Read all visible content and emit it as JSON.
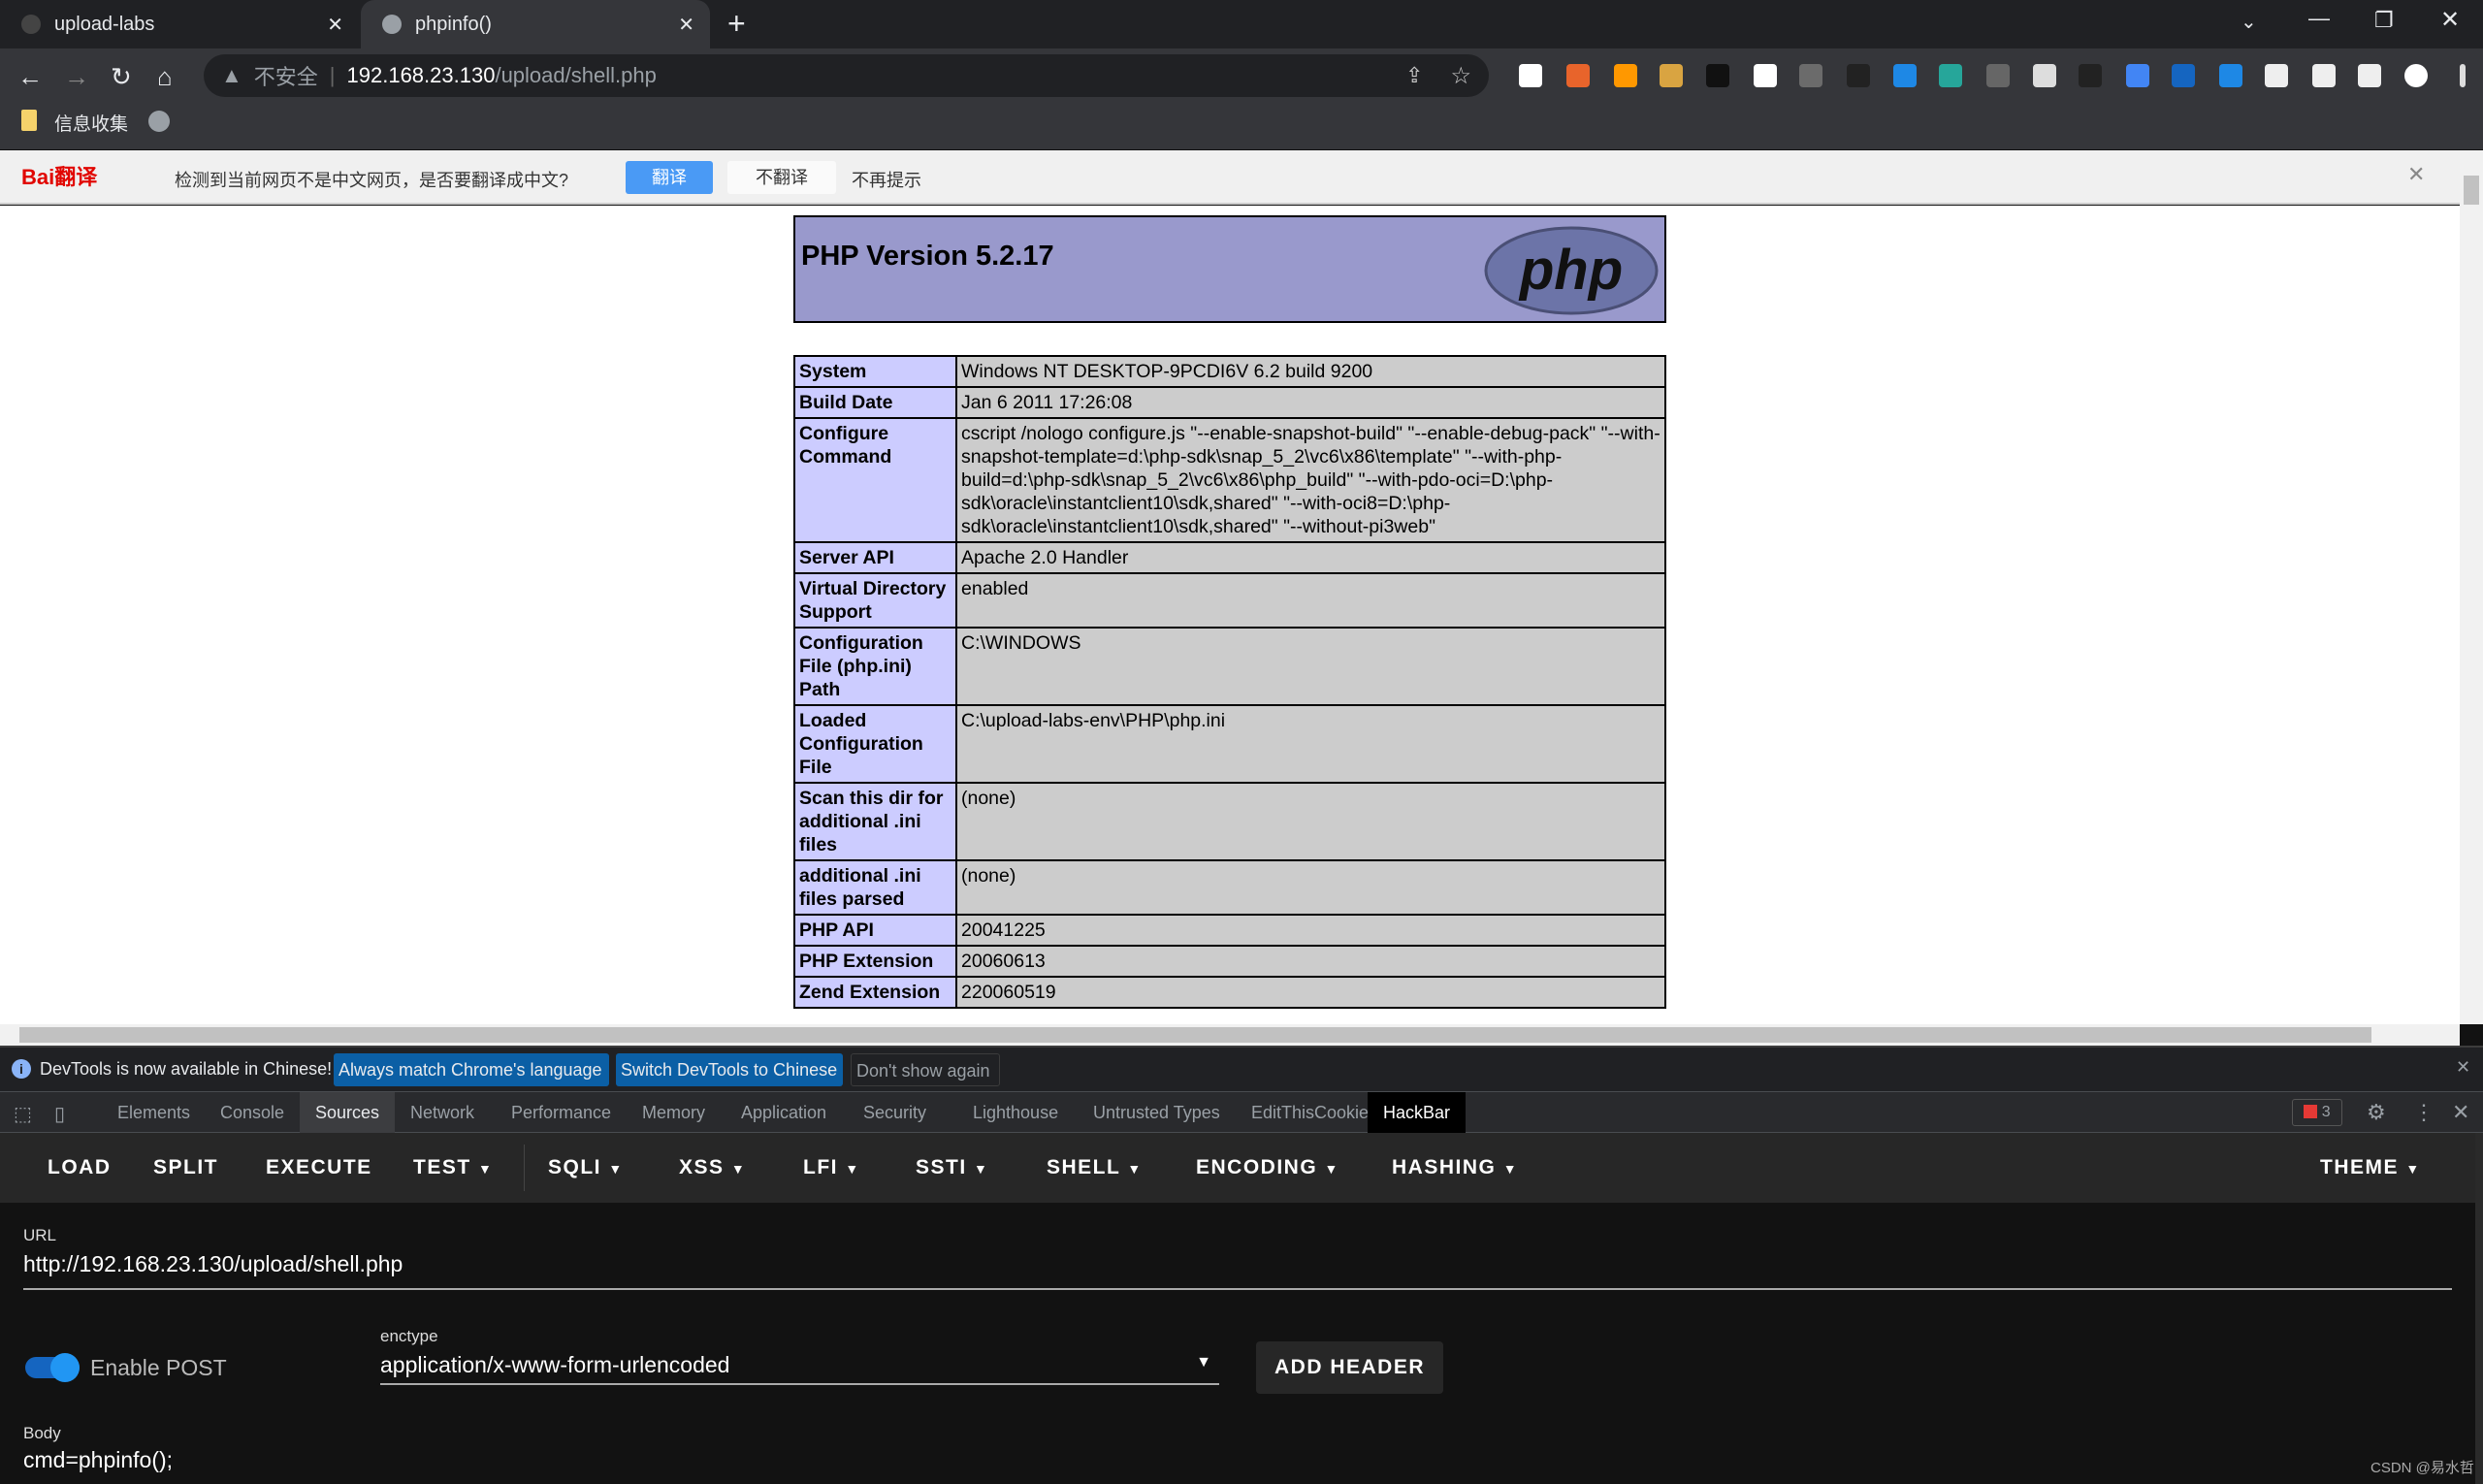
{
  "browser": {
    "tabs": [
      {
        "title": "upload-labs",
        "icon": "page-icon"
      },
      {
        "title": "phpinfo()",
        "icon": "globe-icon"
      }
    ],
    "address": {
      "security": "不安全",
      "host": "192.168.23.130",
      "path": "/upload/shell.php"
    },
    "bookmarks": [
      {
        "label": "信息收集",
        "icon": "folder-icon"
      }
    ],
    "extensions": [
      "search-icon",
      "opera-icon",
      "wappalyzer-icon",
      "cookie-icon",
      "hackbar-icon",
      "proxy-icon",
      "code-icon",
      "glasses-icon",
      "mask-icon",
      "devtools-icon",
      "notepad-icon",
      "cloud-icon",
      "hat-icon",
      "google-translate-icon",
      "translate-icon",
      "baidu-translate-icon",
      "puzzle-icon",
      "flask-icon",
      "sidepanel-icon",
      "profile-icon",
      "menu-icon"
    ],
    "ext_colors": [
      "#ffffff",
      "#e8642b",
      "#ff9800",
      "#d9a441",
      "#111111",
      "#ffffff",
      "#6b6b6b",
      "#222222",
      "#1e88e5",
      "#26a69a",
      "#666666",
      "#dddddd",
      "#222222",
      "#4285f4",
      "#1565c0",
      "#1e88e5",
      "#eeeeee",
      "#eeeeee",
      "#eeeeee",
      "#ffffff",
      "#dddddd"
    ]
  },
  "translate_bar": {
    "brand": "Bai翻译",
    "message": "检测到当前网页不是中文网页，是否要翻译成中文?",
    "translate": "翻译",
    "no_translate": "不翻译",
    "never": "不再提示"
  },
  "phpinfo": {
    "title": "PHP Version 5.2.17",
    "logo": "php",
    "rows": [
      {
        "k": "System",
        "v": "Windows NT DESKTOP-9PCDI6V 6.2 build 9200"
      },
      {
        "k": "Build Date",
        "v": "Jan 6 2011 17:26:08"
      },
      {
        "k": "Configure Command",
        "v": "cscript /nologo configure.js \"--enable-snapshot-build\" \"--enable-debug-pack\" \"--with-snapshot-template=d:\\php-sdk\\snap_5_2\\vc6\\x86\\template\" \"--with-php-build=d:\\php-sdk\\snap_5_2\\vc6\\x86\\php_build\" \"--with-pdo-oci=D:\\php-sdk\\oracle\\instantclient10\\sdk,shared\" \"--with-oci8=D:\\php-sdk\\oracle\\instantclient10\\sdk,shared\" \"--without-pi3web\""
      },
      {
        "k": "Server API",
        "v": "Apache 2.0 Handler"
      },
      {
        "k": "Virtual Directory Support",
        "v": "enabled"
      },
      {
        "k": "Configuration File (php.ini) Path",
        "v": "C:\\WINDOWS"
      },
      {
        "k": "Loaded Configuration File",
        "v": "C:\\upload-labs-env\\PHP\\php.ini"
      },
      {
        "k": "Scan this dir for additional .ini files",
        "v": "(none)"
      },
      {
        "k": "additional .ini files parsed",
        "v": "(none)"
      },
      {
        "k": "PHP API",
        "v": "20041225"
      },
      {
        "k": "PHP Extension",
        "v": "20060613"
      },
      {
        "k": "Zend Extension",
        "v": "220060519"
      }
    ]
  },
  "devtools": {
    "infobar": {
      "message": "DevTools is now available in Chinese!",
      "btn1": "Always match Chrome's language",
      "btn2": "Switch DevTools to Chinese",
      "btn3": "Don't show again"
    },
    "tabs": [
      "Elements",
      "Console",
      "Sources",
      "Network",
      "Performance",
      "Memory",
      "Application",
      "Security",
      "Lighthouse",
      "Untrusted Types",
      "EditThisCookie",
      "HackBar"
    ],
    "error_count": "3"
  },
  "hackbar": {
    "menu": [
      {
        "label": "LOAD"
      },
      {
        "label": "SPLIT"
      },
      {
        "label": "EXECUTE"
      },
      {
        "label": "TEST",
        "dd": true
      },
      {
        "label": "SQLI",
        "dd": true
      },
      {
        "label": "XSS",
        "dd": true
      },
      {
        "label": "LFI",
        "dd": true
      },
      {
        "label": "SSTI",
        "dd": true
      },
      {
        "label": "SHELL",
        "dd": true
      },
      {
        "label": "ENCODING",
        "dd": true
      },
      {
        "label": "HASHING",
        "dd": true
      }
    ],
    "theme": "THEME",
    "url_label": "URL",
    "url": "http://192.168.23.130/upload/shell.php",
    "enable_post": "Enable POST",
    "enable_post_on": true,
    "enctype_label": "enctype",
    "enctype": "application/x-www-form-urlencoded",
    "add_header": "ADD HEADER",
    "body_label": "Body",
    "body": "cmd=phpinfo();",
    "accent": "#2196f3"
  },
  "watermark": "CSDN @易水哲"
}
